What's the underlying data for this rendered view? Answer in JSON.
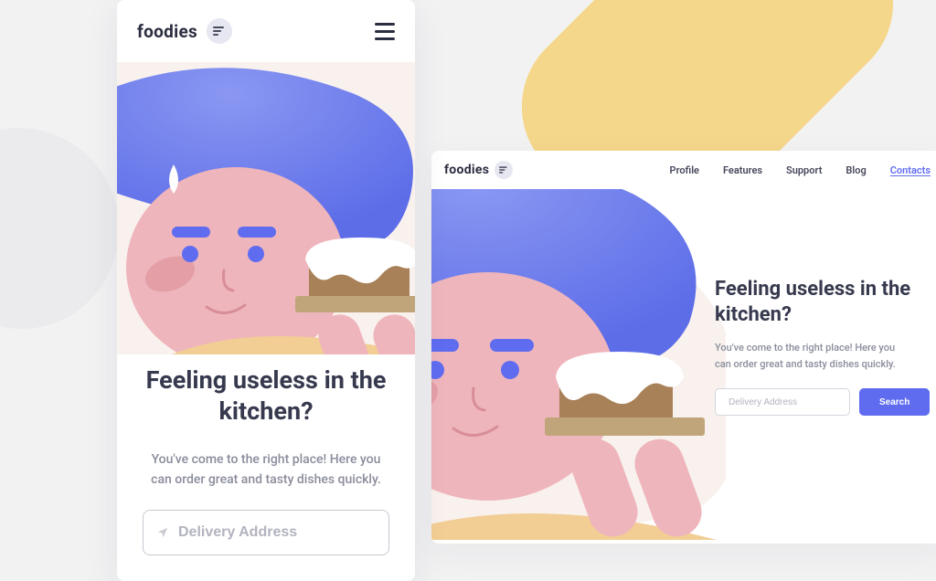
{
  "brand": {
    "name": "foodies",
    "icon": "bars-staggered-icon"
  },
  "nav": {
    "items": [
      {
        "label": "Profile"
      },
      {
        "label": "Features"
      },
      {
        "label": "Support"
      },
      {
        "label": "Blog"
      },
      {
        "label": "Contacts",
        "active": true
      }
    ]
  },
  "hero": {
    "heading": "Feeling useless in the kitchen?",
    "subheading": "You've come to the right place! Here you can order great and tasty dishes quickly.",
    "input_placeholder": "Delivery Address",
    "search_label": "Search"
  },
  "colors": {
    "primary": "#5f6cf0",
    "accent_yellow": "#f4d78a",
    "skin": "#efb5bc",
    "skin_dark": "#e39ea6",
    "hair": "#6a7bea",
    "cake_brown": "#a88159",
    "tray": "#c0a57b",
    "shirt": "#f2ce95"
  }
}
